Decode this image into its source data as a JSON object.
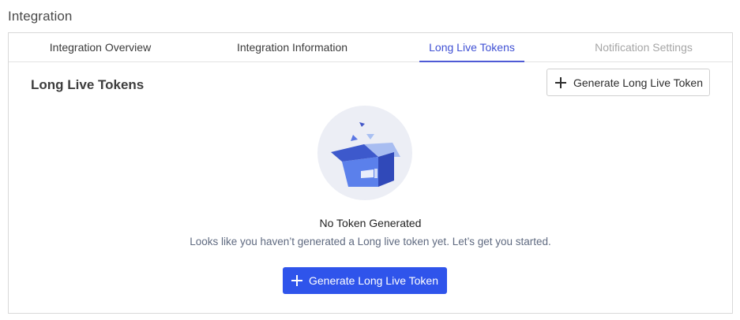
{
  "page": {
    "title": "Integration"
  },
  "tabs": [
    {
      "label": "Integration Overview",
      "state": "normal"
    },
    {
      "label": "Integration Information",
      "state": "normal"
    },
    {
      "label": "Long Live Tokens",
      "state": "active"
    },
    {
      "label": "Notification Settings",
      "state": "disabled"
    }
  ],
  "section": {
    "title": "Long Live Tokens",
    "header_button_label": "Generate Long Live Token",
    "header_button_icon": "plus-icon"
  },
  "empty_state": {
    "illustration": "open-box-illustration",
    "title": "No Token Generated",
    "description": "Looks like you haven’t generated a Long live token yet. Let’s get you started.",
    "button_label": "Generate Long Live Token",
    "button_icon": "plus-icon"
  },
  "colors": {
    "accent": "#2f54eb",
    "active_tab": "#4051d4",
    "disabled_tab": "#a6a6a6"
  }
}
